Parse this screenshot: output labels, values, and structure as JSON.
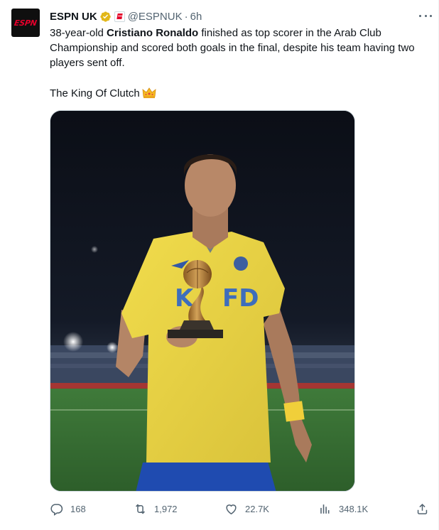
{
  "account": {
    "display_name": "ESPN UK",
    "handle": "@ESPNUK",
    "separator": "·",
    "time": "6h",
    "avatar_label": "ESPN",
    "verified": true
  },
  "tweet": {
    "text_before": "38-year-old ",
    "text_bold": "Cristiano Ronaldo",
    "text_after": " finished as top scorer in the Arab Club Championship and scored both goals in the final, despite his team having two players sent off.",
    "tagline": "The King Of Clutch",
    "tagline_emoji": "crown"
  },
  "media": {
    "description": "photo"
  },
  "stats": {
    "replies": "168",
    "retweets": "1,972",
    "likes": "22.7K",
    "views": "348.1K"
  },
  "colors": {
    "espn_red": "#e4002b",
    "muted": "#536471",
    "text": "#0f1419",
    "verified_gold": "#e2b719"
  },
  "icons": [
    "verified-badge-icon",
    "affiliate-badge-icon",
    "more-icon",
    "reply-icon",
    "retweet-icon",
    "like-icon",
    "views-icon",
    "share-icon",
    "crown-icon"
  ]
}
